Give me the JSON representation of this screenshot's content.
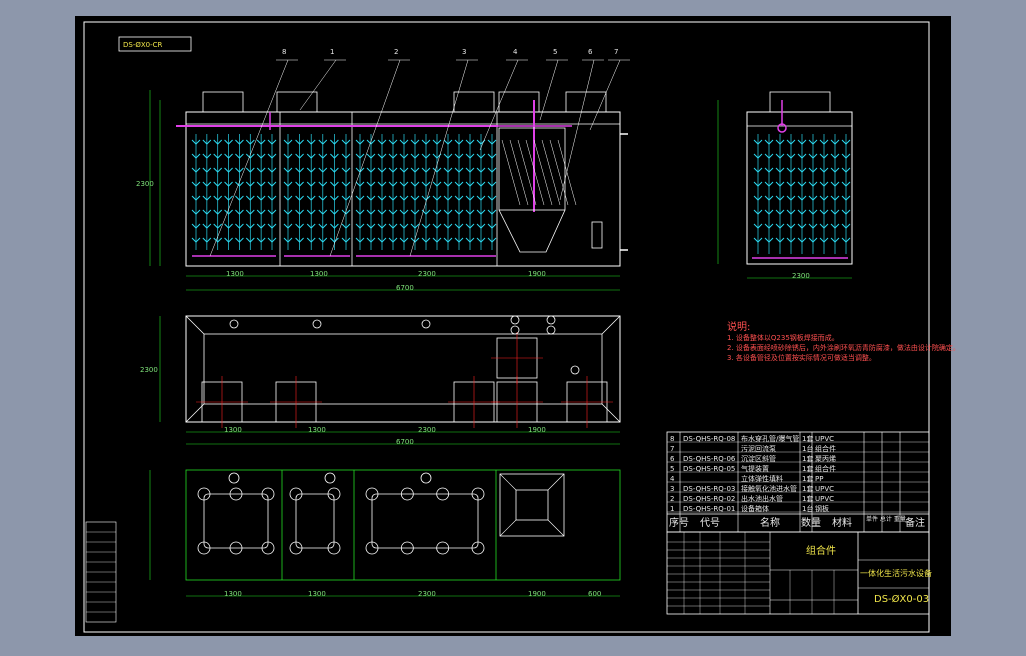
{
  "drawing_code_box": "DS-ØX0-CR",
  "part_numbers": [
    "8",
    "1",
    "2",
    "3",
    "4",
    "5",
    "6",
    "7"
  ],
  "notes": {
    "title": "说明:",
    "lines": [
      "1. 设备整体以Q235钢板焊接而成。",
      "2. 设备表面经喷砂除锈后，内外涂刷环氧沥青防腐漆，做法由设计院确定。",
      "3. 各设备管径及位置按实际情况可做适当调整。"
    ]
  },
  "bom": {
    "rows": [
      {
        "no": "8",
        "code": "DS-QHS-RQ-08",
        "name": "布水穿孔管/曝气管",
        "qty": "1套",
        "mat": "UPVC"
      },
      {
        "no": "7",
        "code": "",
        "name": "污泥回流泵",
        "qty": "1台",
        "mat": "组合件"
      },
      {
        "no": "6",
        "code": "DS-QHS-RQ-06",
        "name": "沉淀区斜管",
        "qty": "1套",
        "mat": "聚丙烯"
      },
      {
        "no": "5",
        "code": "DS-QHS-RQ-05",
        "name": "气提装置",
        "qty": "1套",
        "mat": "组合件"
      },
      {
        "no": "4",
        "code": "",
        "name": "立体弹性填料",
        "qty": "1套",
        "mat": "PP"
      },
      {
        "no": "3",
        "code": "DS-QHS-RQ-03",
        "name": "接触氧化池进水管",
        "qty": "1套",
        "mat": "UPVC"
      },
      {
        "no": "2",
        "code": "DS-QHS-RQ-02",
        "name": "出水池出水管",
        "qty": "1套",
        "mat": "UPVC"
      },
      {
        "no": "1",
        "code": "DS-QHS-RQ-01",
        "name": "设备箱体",
        "qty": "1台",
        "mat": "钢板"
      }
    ],
    "header": {
      "no": "序号",
      "code": "代号",
      "name": "名称",
      "qty": "数量",
      "mat": "材料",
      "weight": "单件 总计 重量",
      "remark": "备注"
    }
  },
  "title_block": {
    "assembly": "组合件",
    "product_name": "一体化生活污水设备",
    "drawing_no": "DS-ØX0-03"
  },
  "dimensions": {
    "front_bottom": [
      "1300",
      "1300",
      "2300",
      "1900"
    ],
    "front_total": "6700",
    "side_bottom": "2300",
    "front_height": "2300",
    "plan_bottom": [
      "1300",
      "1300",
      "2300",
      "1900"
    ],
    "plan_total": "6700",
    "plan_height": "2300",
    "section_bottom": [
      "1300",
      "1300",
      "2300",
      "1900",
      "600"
    ]
  },
  "colors": {
    "background": "#000000",
    "frame": "#ffffff",
    "dimension": "#22dd22",
    "fill_media": "#2bd9f0",
    "pipe": "#e040e8",
    "center_line": "#ff2020",
    "label": "#f0e54a"
  }
}
